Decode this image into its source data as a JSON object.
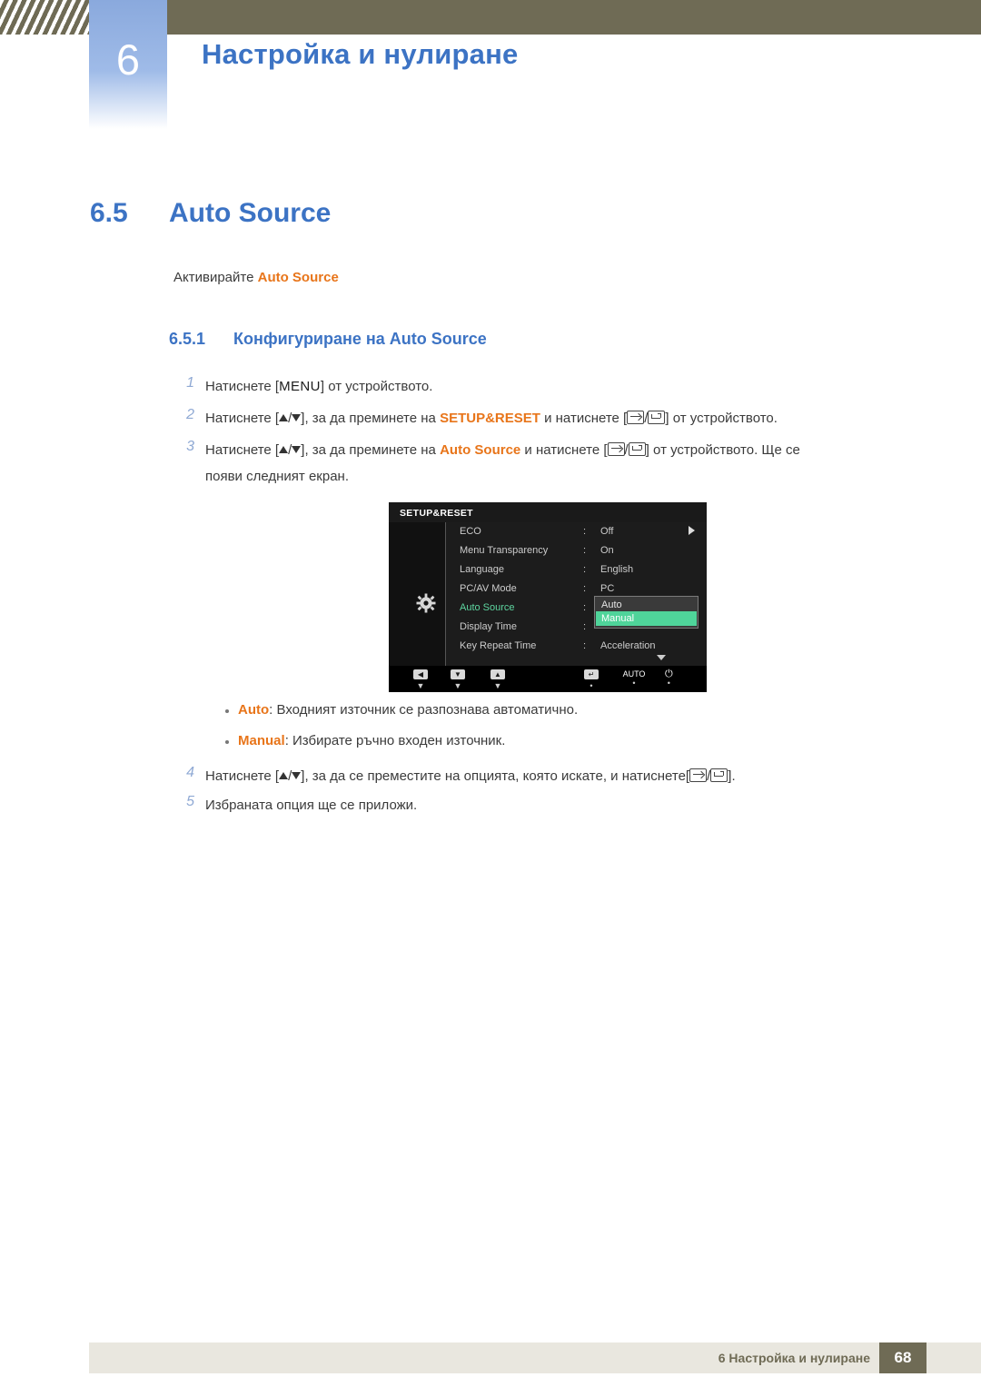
{
  "header": {
    "chapter_number": "6",
    "chapter_title": "Настройка и нулиране"
  },
  "section": {
    "number": "6.5",
    "title": "Auto Source",
    "intro_prefix": "Активирайте ",
    "intro_highlight": "Auto Source"
  },
  "subsection": {
    "number": "6.5.1",
    "title": "Конфигуриране на Auto Source"
  },
  "steps": [
    {
      "num": "1",
      "part1": "Натиснете [",
      "key": "MENU",
      "part2": "] от устройството."
    },
    {
      "num": "2",
      "part1": "Натиснете [",
      "part2": "], за да преминете на ",
      "target": "SETUP&RESET",
      "part3": " и натиснете [",
      "part4": "] от устройството."
    },
    {
      "num": "3",
      "part1": "Натиснете [",
      "part2": "], за да преминете на ",
      "target": "Auto Source",
      "part3": " и натиснете [",
      "part4": "] от устройството. Ще се",
      "line2": "появи следният екран."
    },
    {
      "num": "4",
      "part1": "Натиснете [",
      "part2": "], за да се преместите на опцията, която искате, и натиснете[",
      "part3": "]."
    },
    {
      "num": "5",
      "part1": "Избраната опция ще се приложи."
    }
  ],
  "bullets": [
    {
      "label": "Auto",
      "text": ": Входният източник се разпознава автоматично."
    },
    {
      "label": "Manual",
      "text": ": Избирате ръчно входен източник."
    }
  ],
  "osd": {
    "title": "SETUP&RESET",
    "rows": [
      {
        "label": "ECO",
        "colon": ":",
        "value": "Off",
        "selected": false
      },
      {
        "label": "Menu Transparency",
        "colon": ":",
        "value": "On",
        "selected": false
      },
      {
        "label": "Language",
        "colon": ":",
        "value": "English",
        "selected": false
      },
      {
        "label": "PC/AV Mode",
        "colon": ":",
        "value": "PC",
        "selected": false
      },
      {
        "label": "Auto Source",
        "colon": ":",
        "value": "",
        "selected": true
      },
      {
        "label": "Display Time",
        "colon": ":",
        "value": "",
        "selected": false
      },
      {
        "label": "Key Repeat Time",
        "colon": ":",
        "value": "Acceleration",
        "selected": false
      }
    ],
    "popup": {
      "option1": "Auto",
      "option2": "Manual"
    },
    "footer_buttons": [
      {
        "icon": "◀",
        "caption": "",
        "dot": "▼"
      },
      {
        "icon": "▼",
        "caption": "",
        "dot": "▼"
      },
      {
        "icon": "▲",
        "caption": "",
        "dot": "▼"
      },
      {
        "icon": "↵",
        "caption": "",
        "dot": "•"
      },
      {
        "icon": "",
        "caption": "AUTO",
        "dot": "•"
      },
      {
        "icon": "⏻",
        "caption": "",
        "dot": "•"
      }
    ]
  },
  "footer": {
    "text": "6 Настройка и нулиране",
    "page": "68"
  },
  "colors": {
    "accent_blue": "#3c73c4",
    "orange": "#e8751a",
    "olive": "#6f6b55",
    "osd_green": "#4fd49a"
  }
}
